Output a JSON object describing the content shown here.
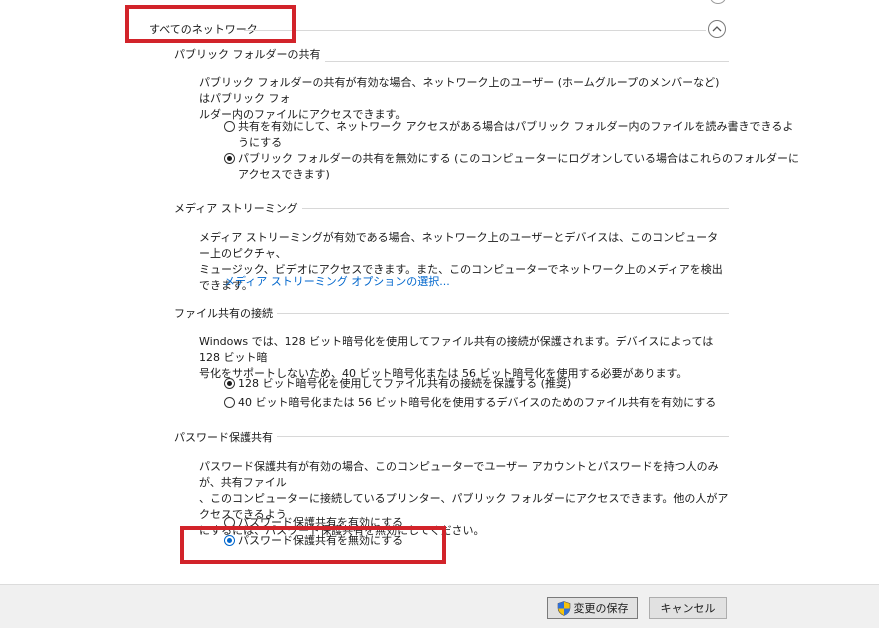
{
  "header": {
    "title": "すべてのネットワーク"
  },
  "sections": {
    "public_folder": {
      "title": "パブリック フォルダーの共有",
      "description_line1": "パブリック フォルダーの共有が有効な場合、ネットワーク上のユーザー (ホームグループのメンバーなど) はパブリック フォ",
      "description_line2": "ルダー内のファイルにアクセスできます。",
      "option1_line1": "共有を有効にして、ネットワーク アクセスがある場合はパブリック フォルダー内のファイルを読み書きできるよ",
      "option1_line2": "うにする",
      "option2_line1": "パブリック フォルダーの共有を無効にする (このコンピューターにログオンしている場合はこれらのフォルダーに",
      "option2_line2": "アクセスできます)"
    },
    "media_streaming": {
      "title": "メディア ストリーミング",
      "description_line1": "メディア ストリーミングが有効である場合、ネットワーク上のユーザーとデバイスは、このコンピューター上のピクチャ、",
      "description_line2": "ミュージック、ビデオにアクセスできます。また、このコンピューターでネットワーク上のメディアを検出できます。",
      "link": "メディア ストリーミング オプションの選択..."
    },
    "file_sharing": {
      "title": "ファイル共有の接続",
      "description_line1": "Windows では、128 ビット暗号化を使用してファイル共有の接続が保護されます。デバイスによっては 128 ビット暗",
      "description_line2": "号化をサポートしないため、40 ビット暗号化または 56 ビット暗号化を使用する必要があります。",
      "option1": "128 ビット暗号化を使用してファイル共有の接続を保護する (推奨)",
      "option2": "40 ビット暗号化または 56 ビット暗号化を使用するデバイスのためのファイル共有を有効にする"
    },
    "password_sharing": {
      "title": "パスワード保護共有",
      "description_line1": "パスワード保護共有が有効の場合、このコンピューターでユーザー アカウントとパスワードを持つ人のみが、共有ファイル",
      "description_line2": "、このコンピューターに接続しているプリンター、パブリック フォルダーにアクセスできます。他の人がアクセスできるよう",
      "description_line3": "にするには、パスワード保護共有を無効にしてください。",
      "option1": "パスワード保護共有を有効にする",
      "option2": "パスワード保護共有を無効にする"
    }
  },
  "footer": {
    "save_label": "変更の保存",
    "cancel_label": "キャンセル"
  },
  "colors": {
    "highlight": "#d2232a",
    "link": "#0066cc"
  }
}
